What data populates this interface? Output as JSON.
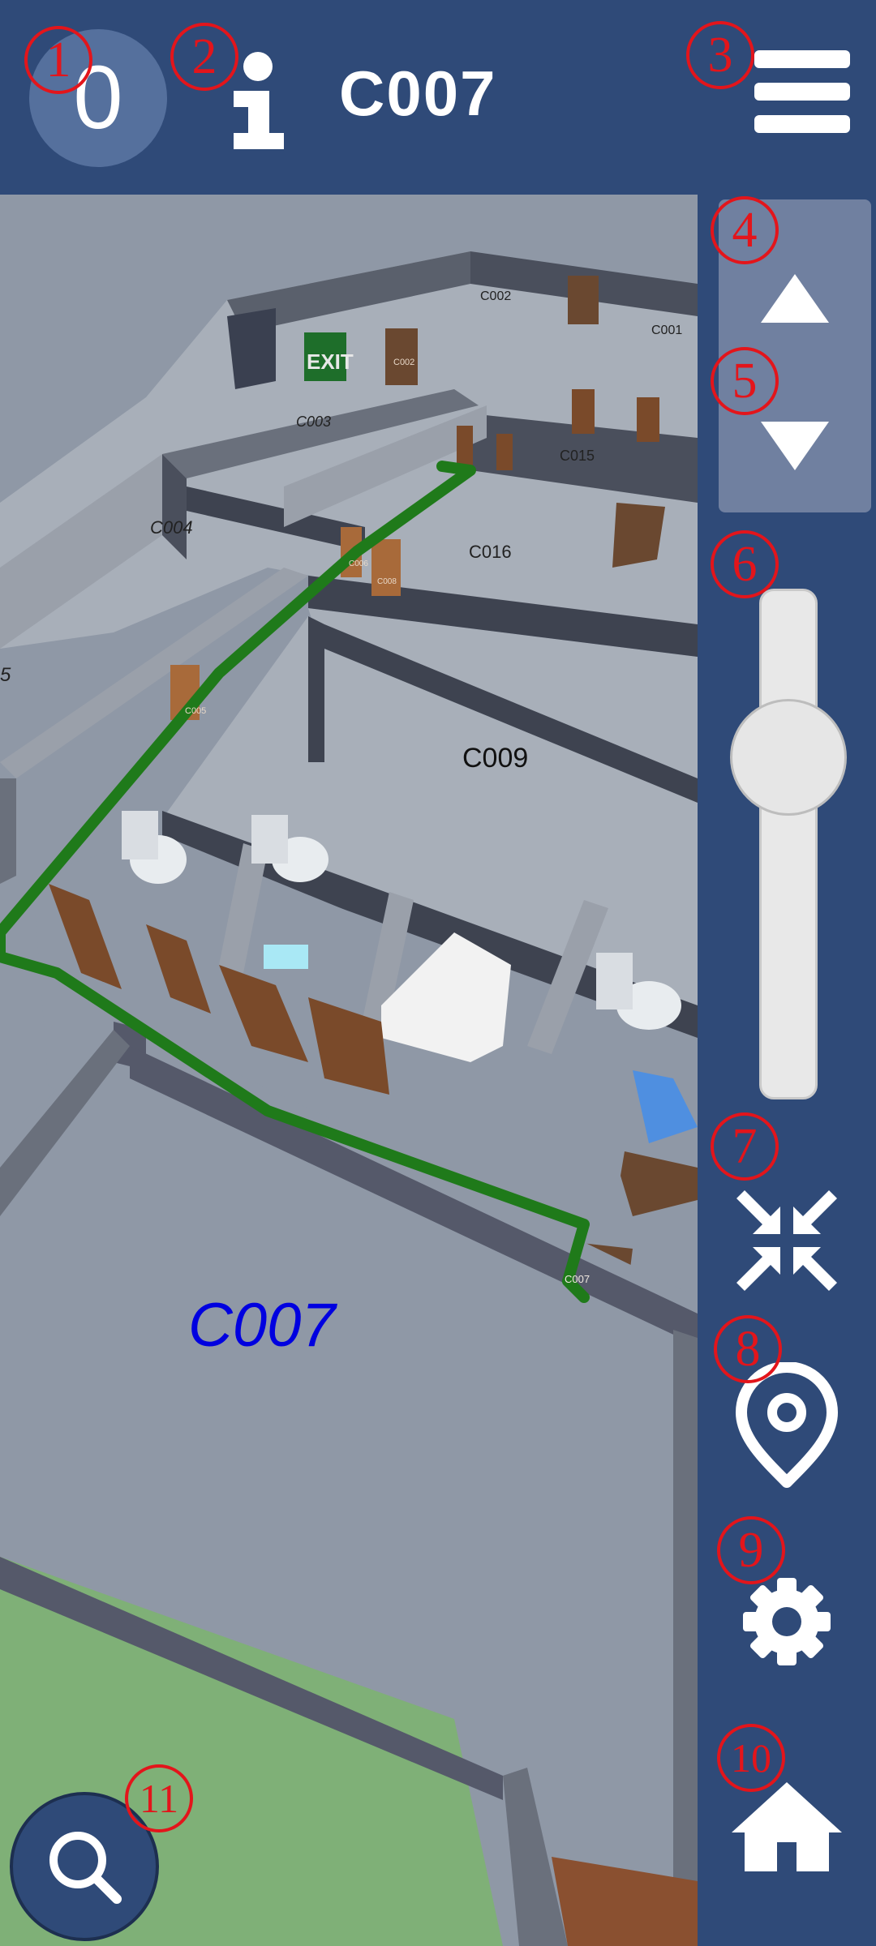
{
  "header": {
    "floor_number": "0",
    "room_title": "C007"
  },
  "map": {
    "current_room": "C007",
    "room_labels": [
      "C002",
      "C001",
      "C003",
      "C015",
      "C004",
      "C016",
      "C009",
      "5"
    ],
    "door_labels": [
      "C002",
      "C006",
      "C005",
      "C008",
      "C007"
    ],
    "exit_sign": "EXIT",
    "route_color": "#1f7a1a"
  },
  "controls": {
    "floor_up_icon": "triangle-up-icon",
    "floor_down_icon": "triangle-down-icon",
    "zoom_slider_level": 0.33
  },
  "icons": {
    "info": "info-icon",
    "menu": "hamburger-icon",
    "collapse": "collapse-arrows-icon",
    "location": "location-pin-icon",
    "settings": "gear-icon",
    "home": "home-icon",
    "search": "search-icon"
  },
  "markers": [
    "1",
    "2",
    "3",
    "4",
    "5",
    "6",
    "7",
    "8",
    "9",
    "10",
    "11"
  ],
  "colors": {
    "bar": "#2f4a78",
    "marker": "#e3151b",
    "current_room_label": "#0000e0"
  }
}
